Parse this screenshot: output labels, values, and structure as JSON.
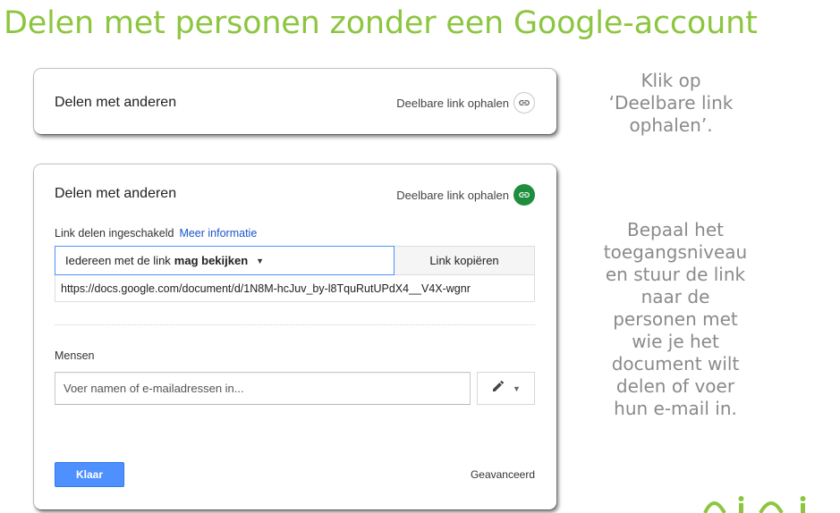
{
  "slide_title": "Delen met personen zonder een Google-account",
  "dialog_collapsed": {
    "title": "Delen met anderen",
    "get_link_label": "Deelbare link ophalen"
  },
  "dialog_expanded": {
    "title": "Delen met anderen",
    "get_link_label": "Deelbare link ophalen",
    "link_sharing_status": "Link delen ingeschakeld",
    "more_info_link": "Meer informatie",
    "access_select": {
      "prefix": "Iedereen met de link",
      "bold_value": "mag bekijken"
    },
    "copy_button_label": "Link kopiëren",
    "share_url": "https://docs.google.com/document/d/1N8M-hcJuv_by-l8TquRutUPdX4__V4X-wgnr",
    "people_label": "Mensen",
    "people_input_placeholder": "Voer namen of e-mailadressen in...",
    "done_button_label": "Klaar",
    "advanced_link": "Geavanceerd"
  },
  "instructions": {
    "step1_lines": [
      "Klik op",
      "‘Deelbare link",
      "ophalen’."
    ],
    "step2_lines": [
      "Bepaal het",
      "toegangsniveau",
      "en stuur de link",
      "naar de",
      "personen met",
      "wie je het",
      "document wilt",
      "delen of voer",
      "hun e-mail in."
    ]
  },
  "icons": {
    "link": "link-icon",
    "edit": "pencil-icon",
    "dropdown": "caret-down-icon"
  },
  "colors": {
    "title_green": "#8cc63f",
    "primary_blue": "#4d90fe",
    "link_blue": "#1a56c9",
    "link_icon_green": "#1e8e3e",
    "instruction_gray": "#8a8a8a"
  }
}
